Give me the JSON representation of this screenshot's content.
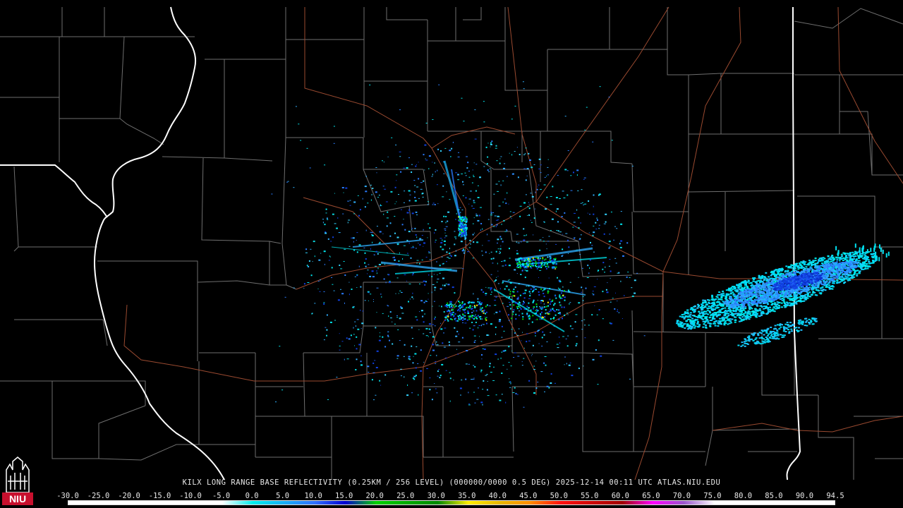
{
  "product_caption": "KILX LONG RANGE BASE REFLECTIVITY (0.25KM / 256 LEVEL) (000000/0000 0.5 DEG) 2025-12-14 00:11 UTC  ATLAS.NIU.EDU",
  "logo": {
    "text": "NIU",
    "icon": "niu-tower-logo-icon",
    "color": "#c8102e"
  },
  "color_scale": {
    "labels": [
      "-30.0",
      "-25.0",
      "-20.0",
      "-15.0",
      "-10.0",
      "-5.0",
      "0.0",
      "5.0",
      "10.0",
      "15.0",
      "20.0",
      "25.0",
      "30.0",
      "35.0",
      "40.0",
      "45.0",
      "50.0",
      "55.0",
      "60.0",
      "65.0",
      "70.0",
      "75.0",
      "80.0",
      "85.0",
      "90.0",
      "94.5"
    ],
    "stops": [
      {
        "value": -30,
        "color": "#ffffff"
      },
      {
        "value": -5,
        "color": "#ffffff"
      },
      {
        "value": 0,
        "color": "#00ecec"
      },
      {
        "value": 10,
        "color": "#3070ff"
      },
      {
        "value": 15,
        "color": "#0000d0"
      },
      {
        "value": 20,
        "color": "#00d000"
      },
      {
        "value": 30,
        "color": "#008800"
      },
      {
        "value": 35,
        "color": "#ffee00"
      },
      {
        "value": 40,
        "color": "#e8b800"
      },
      {
        "value": 45,
        "color": "#ff8c00"
      },
      {
        "value": 50,
        "color": "#ff1010"
      },
      {
        "value": 60,
        "color": "#a00000"
      },
      {
        "value": 65,
        "color": "#ff00ff"
      },
      {
        "value": 70,
        "color": "#9955cc"
      },
      {
        "value": 75,
        "color": "#ffffff"
      },
      {
        "value": 94.5,
        "color": "#ffffff"
      }
    ]
  },
  "colors": {
    "background": "#000000",
    "county_lines": "#6e6e6e",
    "state_lines": "#ffffff",
    "highways": "#9a4a30"
  }
}
